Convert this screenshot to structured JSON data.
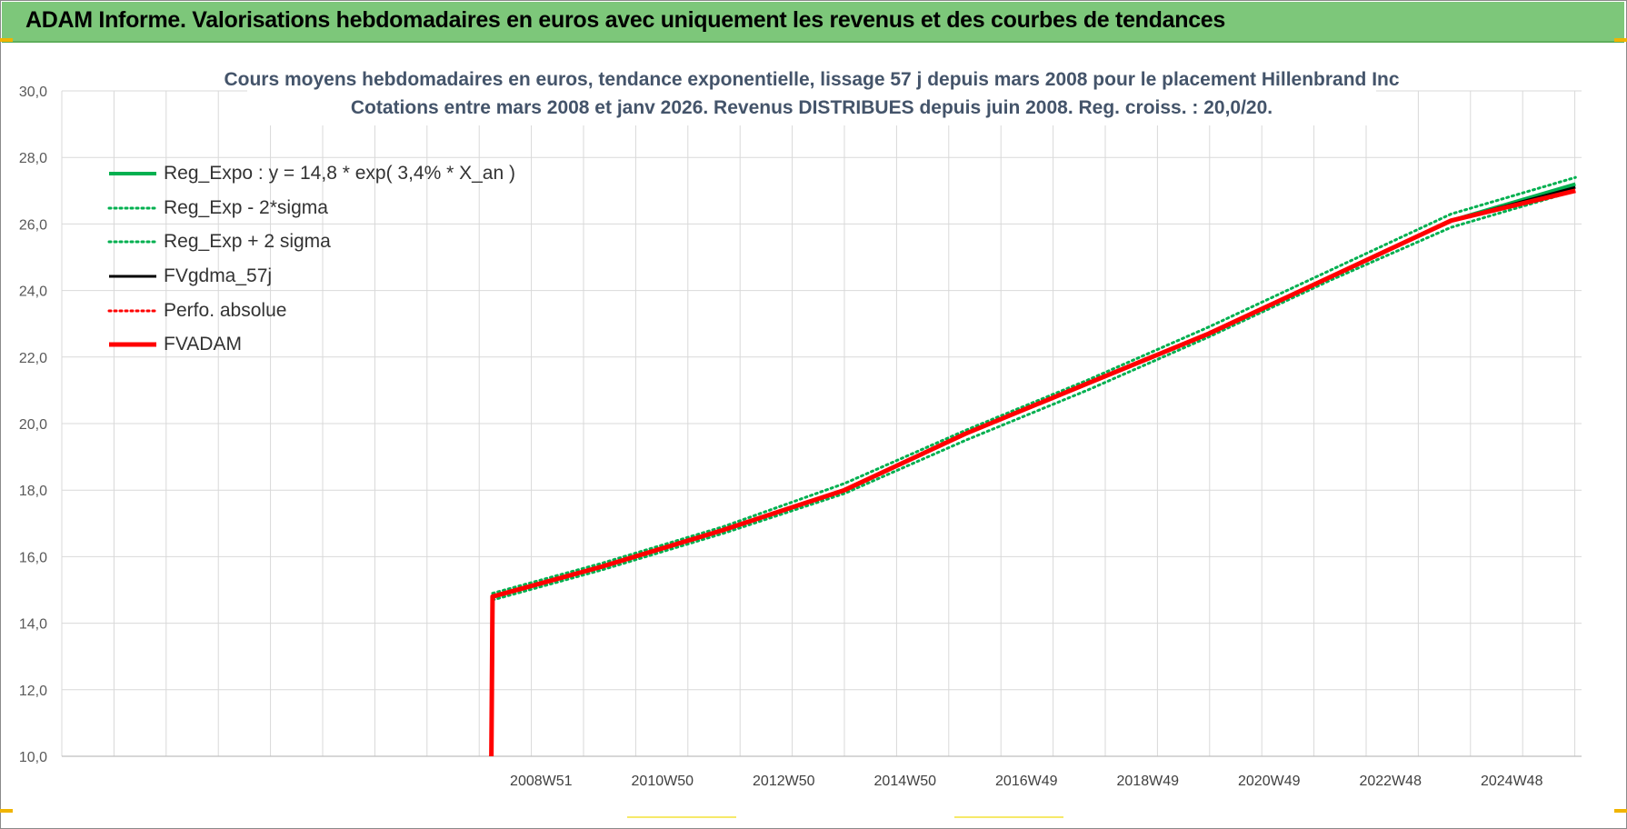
{
  "header": {
    "title": "ADAM Informe. Valorisations hebdomadaires en euros avec uniquement les revenus et des courbes de tendances"
  },
  "chart_data": {
    "type": "line",
    "title_line1": "Cours moyens hebdomadaires en euros, tendance exponentielle, lissage 57 j depuis mars 2008 pour le placement Hillenbrand Inc",
    "title_line2": "Cotations entre mars 2008 et janv 2026. Revenus DISTRIBUES depuis juin 2008. Reg. croiss. : 20,0/20.",
    "ylim": [
      10,
      30
    ],
    "yticks": [
      "10,0",
      "12,0",
      "14,0",
      "16,0",
      "18,0",
      "20,0",
      "22,0",
      "24,0",
      "26,0",
      "28,0",
      "30,0"
    ],
    "xticks": [
      "2008W51",
      "2010W50",
      "2012W50",
      "2014W50",
      "2016W49",
      "2018W49",
      "2020W49",
      "2022W48",
      "2024W48"
    ],
    "grid": true,
    "legend_position": "top-left",
    "series": [
      {
        "name": "Reg_Expo : y = 14,8 * exp( 3,4% *  X_an )",
        "color": "#00b050",
        "style": "solid",
        "x": [
          2008.2,
          2010.0,
          2012.0,
          2014.0,
          2016.0,
          2018.0,
          2020.0,
          2022.0,
          2024.0,
          2026.05
        ],
        "y": [
          14.8,
          15.7,
          16.8,
          18.0,
          19.7,
          21.2,
          22.7,
          24.4,
          26.1,
          27.2
        ]
      },
      {
        "name": "Reg_Exp - 2*sigma",
        "color": "#00b050",
        "style": "dotted",
        "x": [
          2008.2,
          2010.0,
          2012.0,
          2014.0,
          2016.0,
          2018.0,
          2020.0,
          2022.0,
          2024.0,
          2026.05
        ],
        "y": [
          14.7,
          15.6,
          16.7,
          17.9,
          19.5,
          21.0,
          22.6,
          24.3,
          25.9,
          27.0
        ]
      },
      {
        "name": "Reg_Exp + 2 sigma",
        "color": "#00b050",
        "style": "dotted",
        "x": [
          2008.2,
          2010.0,
          2012.0,
          2014.0,
          2016.0,
          2018.0,
          2020.0,
          2022.0,
          2024.0,
          2026.05
        ],
        "y": [
          14.9,
          15.8,
          16.9,
          18.2,
          19.8,
          21.3,
          22.9,
          24.6,
          26.3,
          27.4
        ]
      },
      {
        "name": "FVgdma_57j",
        "color": "#000000",
        "style": "solid",
        "x": [
          2008.18,
          2008.2,
          2010.0,
          2012.0,
          2014.0,
          2016.0,
          2018.0,
          2020.0,
          2022.0,
          2024.0,
          2026.05
        ],
        "y": [
          10.0,
          14.8,
          15.7,
          16.8,
          18.0,
          19.7,
          21.2,
          22.7,
          24.4,
          26.1,
          27.1
        ]
      },
      {
        "name": "Perfo. absolue",
        "color": "#ff0000",
        "style": "dotted",
        "x": [
          2008.2,
          2010.0,
          2012.0,
          2014.0,
          2016.0,
          2018.0,
          2020.0,
          2022.0,
          2024.0,
          2026.05
        ],
        "y": [
          14.8,
          15.7,
          16.8,
          18.0,
          19.7,
          21.2,
          22.7,
          24.4,
          26.1,
          27.0
        ]
      },
      {
        "name": "FVADAM",
        "color": "#ff0000",
        "style": "thick",
        "x": [
          2008.18,
          2008.2,
          2010.0,
          2012.0,
          2014.0,
          2016.0,
          2018.0,
          2020.0,
          2022.0,
          2024.0,
          2026.05
        ],
        "y": [
          10.0,
          14.8,
          15.7,
          16.8,
          18.0,
          19.7,
          21.2,
          22.7,
          24.4,
          26.1,
          27.0
        ]
      }
    ]
  }
}
